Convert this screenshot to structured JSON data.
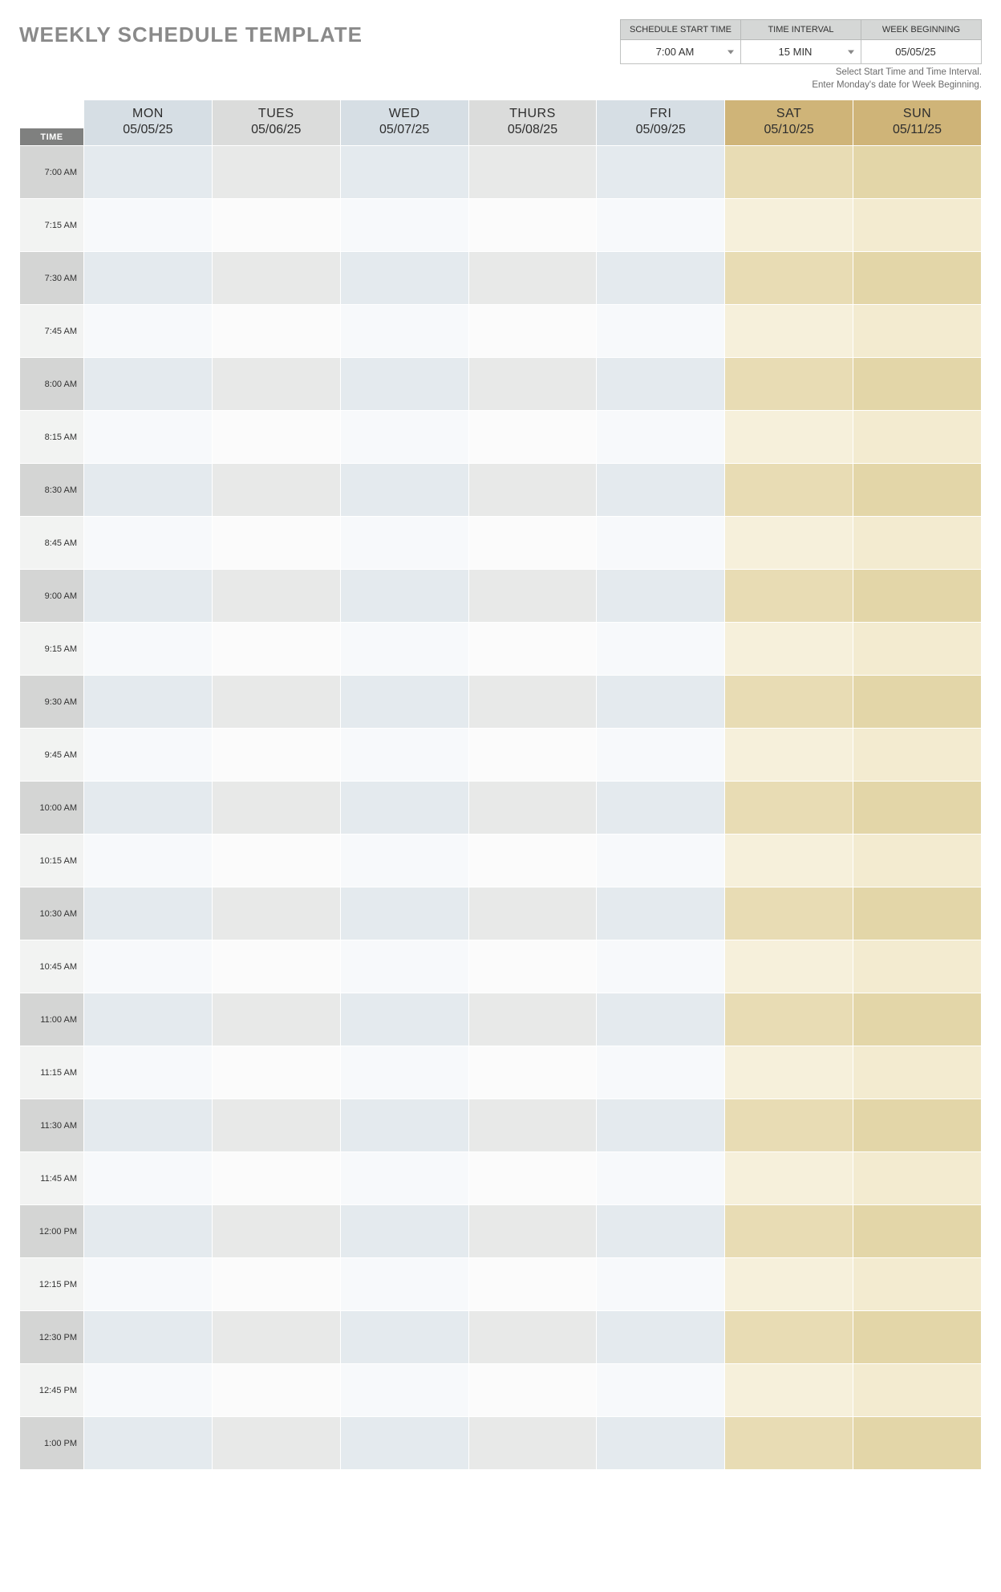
{
  "title": "WEEKLY SCHEDULE TEMPLATE",
  "helper": {
    "line1": "Select Start Time and Time Interval.",
    "line2": "Enter Monday's date for Week Beginning."
  },
  "controls": {
    "headers": {
      "start": "SCHEDULE START TIME",
      "interval": "TIME INTERVAL",
      "week": "WEEK BEGINNING"
    },
    "values": {
      "start": "7:00 AM",
      "interval": "15 MIN",
      "week": "05/05/25"
    }
  },
  "timeHeader": "TIME",
  "days": [
    {
      "name": "MON",
      "date": "05/05/25",
      "type": "weekday",
      "alt": false
    },
    {
      "name": "TUES",
      "date": "05/06/25",
      "type": "weekday",
      "alt": true
    },
    {
      "name": "WED",
      "date": "05/07/25",
      "type": "weekday",
      "alt": false
    },
    {
      "name": "THURS",
      "date": "05/08/25",
      "type": "weekday",
      "alt": true
    },
    {
      "name": "FRI",
      "date": "05/09/25",
      "type": "weekday",
      "alt": false
    },
    {
      "name": "SAT",
      "date": "05/10/25",
      "type": "weekend",
      "alt": false
    },
    {
      "name": "SUN",
      "date": "05/11/25",
      "type": "weekend",
      "alt": true
    }
  ],
  "timeSlots": [
    "7:00 AM",
    "7:15 AM",
    "7:30 AM",
    "7:45 AM",
    "8:00 AM",
    "8:15 AM",
    "8:30 AM",
    "8:45 AM",
    "9:00 AM",
    "9:15 AM",
    "9:30 AM",
    "9:45 AM",
    "10:00 AM",
    "10:15 AM",
    "10:30 AM",
    "10:45 AM",
    "11:00 AM",
    "11:15 AM",
    "11:30 AM",
    "11:45 AM",
    "12:00 PM",
    "12:15 PM",
    "12:30 PM",
    "12:45 PM",
    "1:00 PM"
  ]
}
